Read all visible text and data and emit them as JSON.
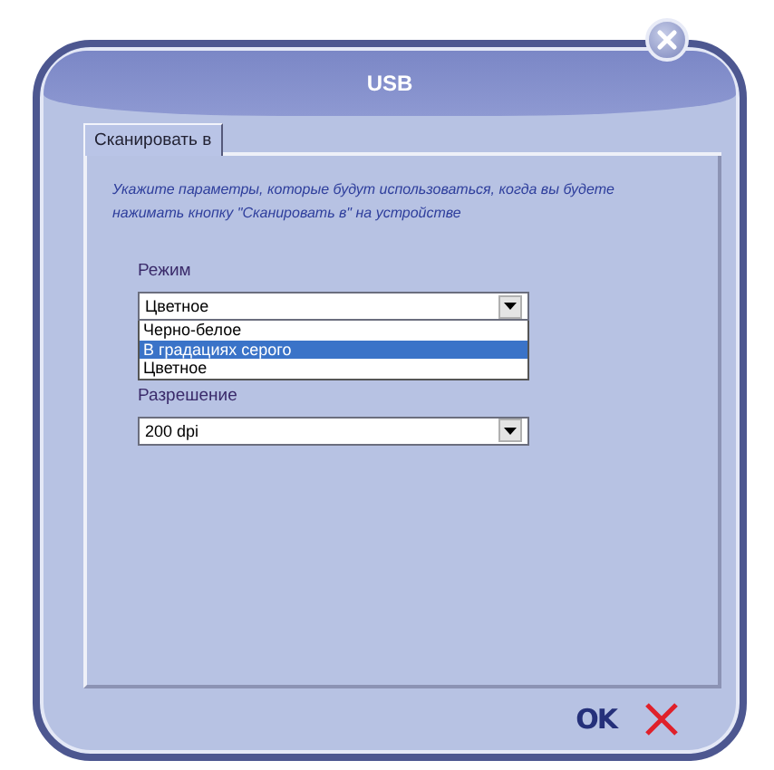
{
  "window": {
    "title": "USB"
  },
  "tabs": [
    {
      "label": "Сканировать в",
      "selected": true
    }
  ],
  "instructions": "Укажите параметры, которые будут использоваться, когда вы будете нажимать кнопку \"Сканировать в\"  на устройстве",
  "mode": {
    "label": "Режим",
    "value": "Цветное",
    "expanded": true,
    "options": [
      {
        "label": "Черно-белое",
        "highlighted": false
      },
      {
        "label": "В градациях серого",
        "highlighted": true
      },
      {
        "label": "Цветное",
        "highlighted": false
      }
    ]
  },
  "resolution": {
    "label": "Разрешение",
    "value": "200 dpi",
    "expanded": false
  },
  "buttons": {
    "ok": "OK"
  }
}
